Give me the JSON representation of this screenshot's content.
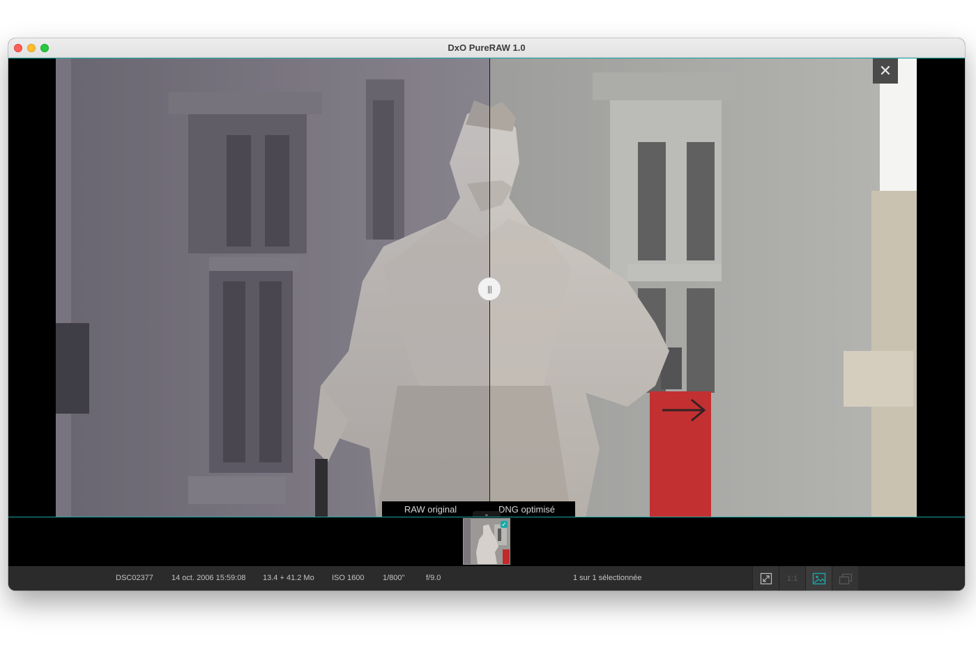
{
  "window": {
    "title": "DxO PureRAW 1.0"
  },
  "viewer": {
    "compare_labels": {
      "left": "RAW original",
      "right": "DNG optimisé"
    },
    "close_glyph": "✕",
    "split_position": 0.5
  },
  "filmstrip": {
    "items": [
      {
        "selected": true
      }
    ]
  },
  "status": {
    "filename": "DSC02377",
    "date": "14 oct. 2006 15:59:08",
    "size": "13.4 + 41.2 Mo",
    "iso": "ISO 1600",
    "shutter": "1/800\"",
    "aperture": "f/9.0",
    "selection": "1 sur 1 sélectionnée",
    "tools": [
      {
        "icon": "fullscreen-icon",
        "active": false
      },
      {
        "icon": "zoom-1-1-icon",
        "label": "1:1",
        "active": false,
        "enabled": false
      },
      {
        "icon": "single-image-view-icon",
        "active": true
      },
      {
        "icon": "compare-view-icon",
        "active": false,
        "enabled": false
      }
    ]
  },
  "colors": {
    "accent": "#1aa7a7",
    "statusbar": "#2b2b2b",
    "titlebar": "#e8e8e8"
  }
}
